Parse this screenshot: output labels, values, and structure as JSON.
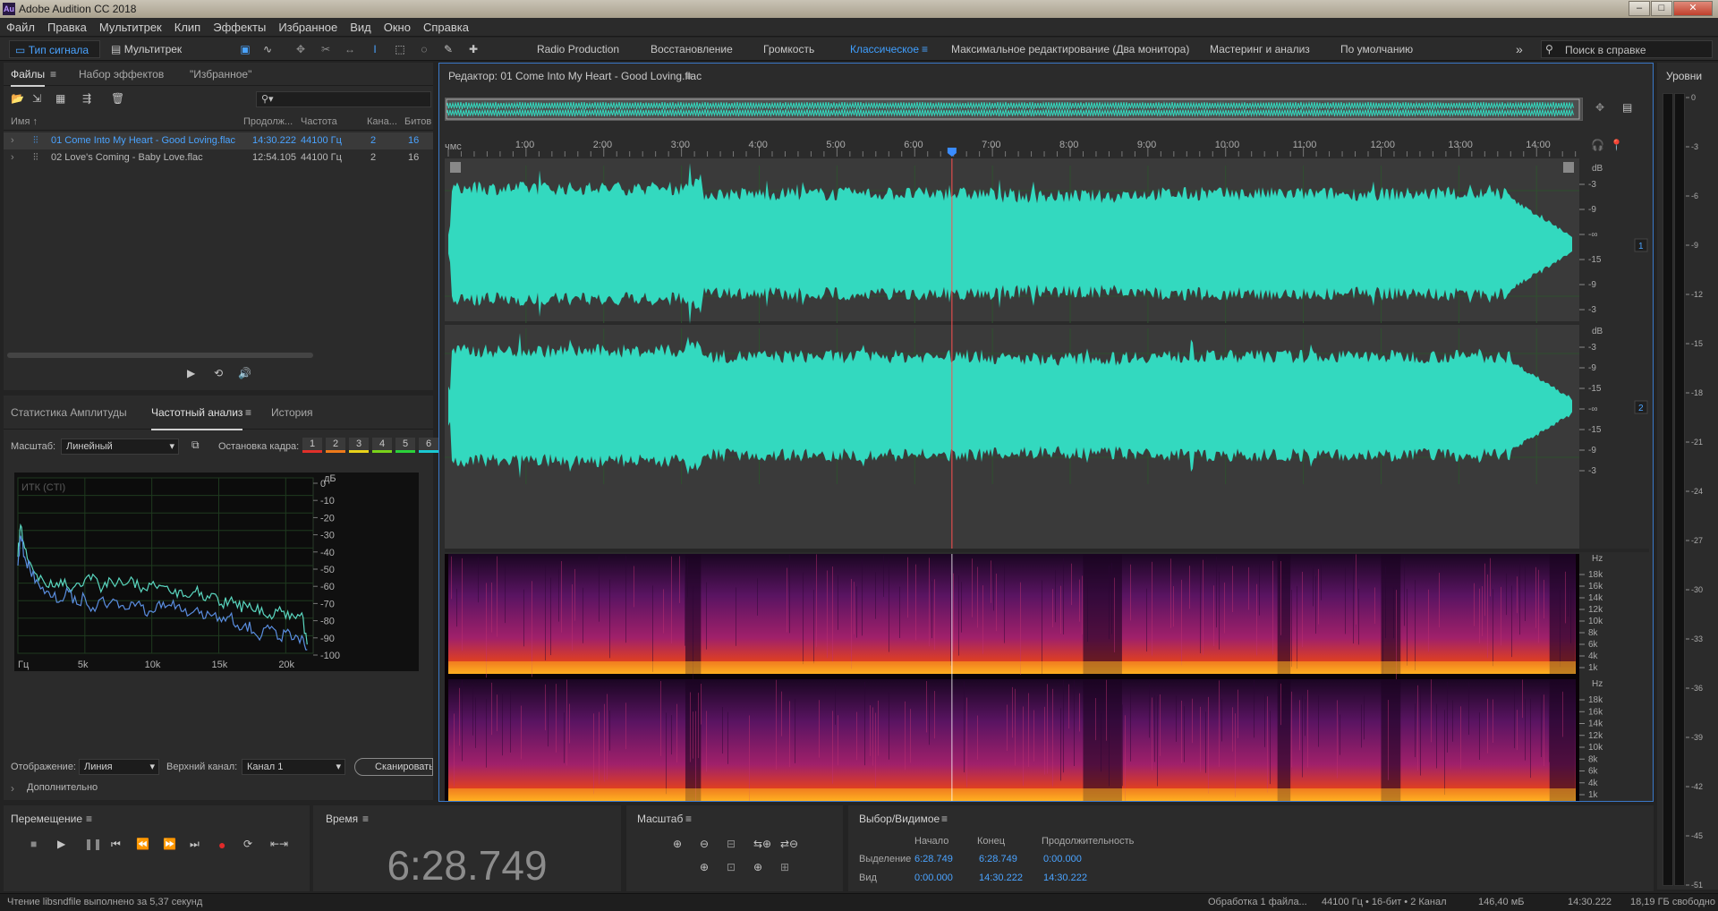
{
  "window": {
    "title": "Adobe Audition CC 2018",
    "logo_text": "Au"
  },
  "menu": [
    "Файл",
    "Правка",
    "Мультитрек",
    "Клип",
    "Эффекты",
    "Избранное",
    "Вид",
    "Окно",
    "Справка"
  ],
  "toolbar": {
    "waveform_label": "Тип сигнала",
    "multitrack_label": "Мультитрек",
    "workspaces": [
      "Radio Production",
      "Восстановление",
      "Громкость",
      "Классическое",
      "Максимальное редактирование (Два монитора)",
      "Мастеринг и анализ",
      "По умолчанию"
    ],
    "active_workspace": "Классическое",
    "search_placeholder": "Поиск в справке"
  },
  "files_panel": {
    "tabs": [
      "Файлы",
      "Набор эффектов",
      "\"Избранное\""
    ],
    "columns": [
      "Имя",
      "Продолж...",
      "Частота",
      "Кана...",
      "Битов"
    ],
    "rows": [
      {
        "name": "01 Come Into My Heart - Good Loving.flac",
        "duration": "14:30.222",
        "rate": "44100 Гц",
        "channels": "2",
        "bits": "16",
        "selected": true
      },
      {
        "name": "02 Love's Coming - Baby Love.flac",
        "duration": "12:54.105",
        "rate": "44100 Гц",
        "channels": "2",
        "bits": "16",
        "selected": false
      }
    ]
  },
  "analysis_panel": {
    "tabs": [
      "Статистика Амплитуды",
      "Частотный анализ",
      "История"
    ],
    "scale_label": "Масштаб:",
    "scale_value": "Линейный",
    "freeze_label": "Остановка кадра:",
    "freeze_slots": [
      "1",
      "2",
      "3",
      "4",
      "5",
      "6"
    ],
    "freeze_colors": [
      "#e0302a",
      "#ee7a1a",
      "#e8d21a",
      "#7ad21a",
      "#2ad23a",
      "#1ac8d2"
    ],
    "chart_label": "ИТК (CTI)",
    "display_label": "Отображение:",
    "display_value": "Линия",
    "channel_label": "Верхний канал:",
    "channel_value": "Канал 1",
    "scan_label": "Сканировать",
    "advanced_label": "Дополнительно"
  },
  "chart_data": {
    "type": "line",
    "x_unit": "Гц",
    "y_unit": "дБ",
    "x_ticks": [
      "Гц",
      "5k",
      "10k",
      "15k",
      "20k"
    ],
    "y_ticks": [
      "0",
      "-10",
      "-20",
      "-30",
      "-40",
      "-50",
      "-60",
      "-70",
      "-80",
      "-90",
      "-100"
    ],
    "xlim": [
      0,
      22050
    ],
    "ylim": [
      -100,
      0
    ],
    "series": [
      {
        "color": "#5ad7c0",
        "x": [
          0,
          200,
          500,
          900,
          1400,
          2000,
          2600,
          3200,
          3800,
          4400,
          5000,
          5600,
          6200,
          6800,
          7400,
          8000,
          8600,
          9200,
          9800,
          10400,
          11000,
          11600,
          12200,
          12800,
          13400,
          14000,
          14600,
          15200,
          15800,
          16400,
          17000,
          17600,
          18200,
          18800,
          19400,
          20000,
          20600,
          21200,
          21600
        ],
        "y": [
          -45,
          -27,
          -40,
          -48,
          -55,
          -60,
          -62,
          -58,
          -63,
          -60,
          -58,
          -55,
          -65,
          -57,
          -60,
          -61,
          -58,
          -65,
          -60,
          -63,
          -62,
          -66,
          -64,
          -68,
          -62,
          -70,
          -66,
          -72,
          -70,
          -74,
          -72,
          -76,
          -74,
          -78,
          -76,
          -80,
          -79,
          -77,
          -95
        ]
      },
      {
        "color": "#5a8ee0",
        "x": [
          0,
          200,
          500,
          900,
          1400,
          2000,
          2600,
          3200,
          3800,
          4400,
          5000,
          5600,
          6200,
          6800,
          7400,
          8000,
          8600,
          9200,
          9800,
          10400,
          11000,
          11600,
          12200,
          12800,
          13400,
          14000,
          14600,
          15200,
          15800,
          16400,
          17000,
          17600,
          18200,
          18800,
          19400,
          20000,
          20600,
          21200,
          21600
        ],
        "y": [
          -50,
          -33,
          -45,
          -52,
          -58,
          -66,
          -68,
          -70,
          -65,
          -72,
          -68,
          -74,
          -69,
          -72,
          -70,
          -75,
          -71,
          -73,
          -76,
          -72,
          -74,
          -70,
          -76,
          -78,
          -74,
          -80,
          -78,
          -82,
          -79,
          -84,
          -83,
          -88,
          -90,
          -86,
          -92,
          -88,
          -92,
          -90,
          -98
        ]
      }
    ]
  },
  "editor": {
    "title": "Редактор: 01 Come Into My Heart - Good Loving.flac",
    "ruler_unit": "чмс",
    "ruler_ticks": [
      "1:00",
      "2:00",
      "3:00",
      "4:00",
      "5:00",
      "6:00",
      "7:00",
      "8:00",
      "9:00",
      "10:00",
      "11:00",
      "12:00",
      "13:00",
      "14:00"
    ],
    "ruler_seconds": [
      60,
      120,
      180,
      240,
      300,
      360,
      420,
      480,
      540,
      600,
      660,
      720,
      780,
      840
    ],
    "duration_seconds": 870.222,
    "playhead_seconds": 388.749,
    "db_unit": "dB",
    "db_ticks": [
      "-3",
      "-9",
      "-∞",
      "-15",
      "-9",
      "-3"
    ],
    "db_ticks_ch2": [
      "-3",
      "-9",
      "-15",
      "-∞",
      "-15",
      "-9",
      "-3"
    ],
    "hz_unit": "Hz",
    "hz_ticks": [
      "18k",
      "16k",
      "14k",
      "12k",
      "10k",
      "8k",
      "6k",
      "4k",
      "1k"
    ],
    "channel_badges": [
      "1",
      "2"
    ],
    "waveform_color": "#33d9bf",
    "spectral_colors": [
      "#1a0622",
      "#5a1462",
      "#a0206a",
      "#e04020",
      "#ffb020"
    ]
  },
  "levels": {
    "title": "Уровни",
    "ticks": [
      "0",
      "-3",
      "-6",
      "-9",
      "-12",
      "-15",
      "-18",
      "-21",
      "-24",
      "-27",
      "-30",
      "-33",
      "-36",
      "-39",
      "-42",
      "-45",
      "-51"
    ]
  },
  "transport": {
    "title": "Перемещение"
  },
  "time_panel": {
    "title": "Время",
    "value": "6:28.749"
  },
  "zoom_panel": {
    "title": "Масштаб"
  },
  "selection": {
    "title": "Выбор/Видимое",
    "headers": [
      "Начало",
      "Конец",
      "Продолжительность"
    ],
    "rows": [
      {
        "label": "Выделение",
        "start": "6:28.749",
        "end": "6:28.749",
        "duration": "0:00.000"
      },
      {
        "label": "Вид",
        "start": "0:00.000",
        "end": "14:30.222",
        "duration": "14:30.222"
      }
    ]
  },
  "status": {
    "left": "Чтение libsndfile выполнено за 5,37 секунд",
    "processing": "Обработка 1 файла...",
    "format": "44100 Гц • 16-бит • 2 Канал",
    "size": "146,40 мБ",
    "duration": "14:30.222",
    "free": "18,19 ГБ свободно"
  }
}
